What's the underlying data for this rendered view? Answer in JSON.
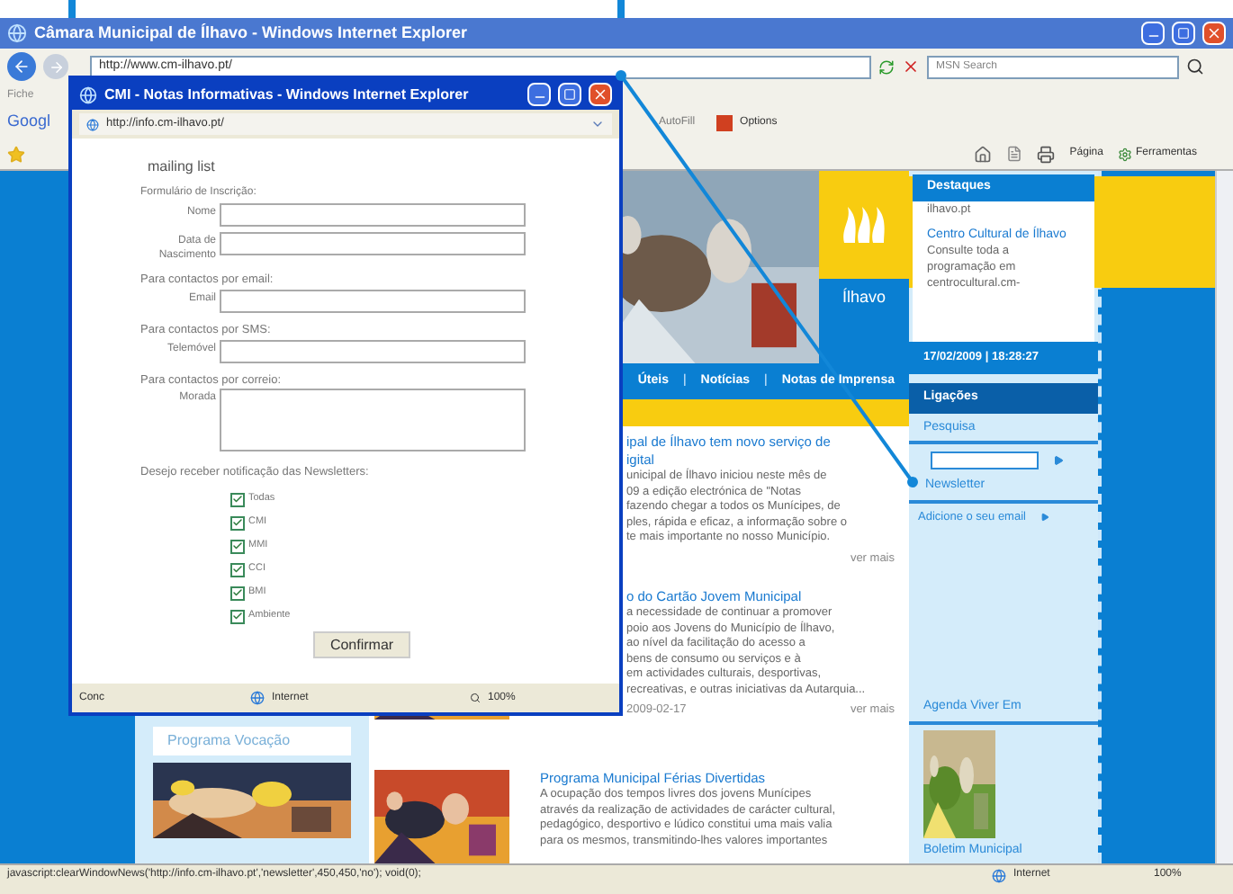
{
  "main_window": {
    "title": "Câmara Municipal de Ílhavo - Windows Internet Explorer",
    "address": "http://www.cm-ilhavo.pt/",
    "search_placeholder": "MSN Search",
    "menu_fragment": "Fiche",
    "google_fragment": "Googl",
    "toolbar_items": [
      "AutoFill",
      "Options"
    ],
    "command_items": [
      "Página",
      "Ferramentas"
    ],
    "status_text": "javascript:clearWindowNews('http://info.cm-ilhavo.pt','newsletter',450,450,'no'); void(0);",
    "status_zone": "Internet",
    "status_zoom": "100%"
  },
  "site": {
    "logo_text": "Ílhavo",
    "nav": [
      {
        "kind": "link",
        "text": "Úteis"
      },
      {
        "kind": "separator",
        "text": "|"
      },
      {
        "kind": "link",
        "text": "Notícias"
      },
      {
        "kind": "separator",
        "text": "|"
      },
      {
        "kind": "link",
        "text": "Notas de Imprensa"
      }
    ],
    "articles": [
      {
        "title_lines": [
          "ipal de Ílhavo tem novo serviço de",
          "igital"
        ],
        "body_lines": [
          "unicipal de Ílhavo iniciou neste mês de",
          "09 a edição electrónica de \"Notas",
          "fazendo chegar a todos os Munícipes, de",
          "ples, rápida e eficaz, a informação sobre o",
          "te mais importante no nosso Município."
        ],
        "more": "ver mais"
      },
      {
        "title_lines": [
          "o do Cartão Jovem Municipal"
        ],
        "body_lines": [
          "a necessidade de continuar a promover",
          "poio aos Jovens do Município de Ílhavo,",
          "ao nível da facilitação do acesso a",
          "bens de consumo ou serviços e à",
          "em actividades culturais, desportivas,",
          "recreativas, e outras iniciativas da Autarquia..."
        ],
        "date": "2009-02-17",
        "more": "ver mais",
        "has_image": true
      },
      {
        "title_lines": [
          "Programa Municipal Férias Divertidas"
        ],
        "body_lines": [
          "A ocupação dos tempos livres dos jovens Munícipes",
          "através da realização de actividades de carácter cultural,",
          "pedagógico, desportivo e lúdico constitui uma mais valia",
          "para os mesmos, transmitindo-lhes valores importantes"
        ],
        "has_image": true
      }
    ],
    "left_feature": "Programa Vocação",
    "highlights": {
      "title": "Destaques",
      "fragment": "ilhavo.pt",
      "link": "Centro Cultural de Ílhavo",
      "text": "Consulte toda a programação em centrocultural.cm-"
    },
    "datetime": "17/02/2009 | 18:28:27",
    "links": {
      "title": "Ligações",
      "search_label": "Pesquisa",
      "newsletter_label": "Newsletter",
      "newsletter_link": "Adicione o seu email",
      "agenda": "Agenda Viver Em",
      "bulletin": "Boletim Municipal"
    }
  },
  "popup": {
    "title": "CMI - Notas Informativas - Windows Internet Explorer",
    "address": "http://info.cm-ilhavo.pt/",
    "heading": "mailing list",
    "form_title": "Formulário de Inscrição:",
    "sections": [
      {
        "fields": [
          {
            "label": "Nome",
            "kind": "text"
          },
          {
            "label": "Data de Nascimento",
            "kind": "text"
          }
        ]
      },
      {
        "heading": "Para contactos por email:",
        "fields": [
          {
            "label": "Email",
            "kind": "text"
          }
        ]
      },
      {
        "heading": "Para contactos por SMS:",
        "fields": [
          {
            "label": "Telemóvel",
            "kind": "text"
          }
        ]
      },
      {
        "heading": "Para contactos por correio:",
        "fields": [
          {
            "label": "Morada",
            "kind": "textarea"
          }
        ]
      }
    ],
    "newsletter_question": "Desejo receber notificação das Newsletters:",
    "newsletters": [
      {
        "label": "Todas",
        "checked": true
      },
      {
        "label": "CMI",
        "checked": true
      },
      {
        "label": "MMI",
        "checked": true
      },
      {
        "label": "CCI",
        "checked": true
      },
      {
        "label": "BMI",
        "checked": true
      },
      {
        "label": "Ambiente",
        "checked": true
      }
    ],
    "submit": "Confirmar",
    "status_left": "Conc",
    "status_zone": "Internet",
    "status_zoom": "100%"
  }
}
